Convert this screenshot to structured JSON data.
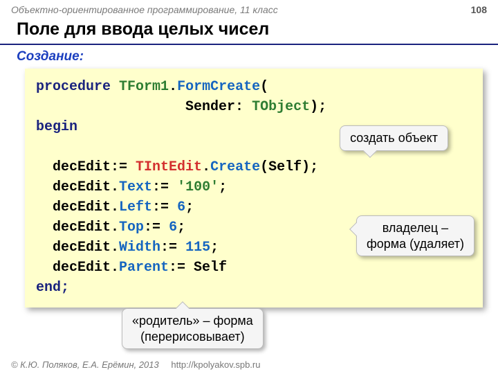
{
  "header": {
    "course": "Объектно-ориентированное программирование, 11 класс",
    "page_number": "108"
  },
  "title": "Поле для ввода целых чисел",
  "subhead": "Создание:",
  "code": {
    "kw_procedure": "procedure",
    "cls_tform1": "TForm1",
    "dot1": ".",
    "method_formcreate": "FormCreate",
    "open_paren": "(",
    "indent1": "                  ",
    "arg_sender": "Sender: ",
    "type_tobject": "TObject",
    "close_sig": ");",
    "kw_begin": "begin",
    "l1_indent": "  ",
    "l1_var": "decEdit:= ",
    "l1_cls": "TIntEdit",
    "l1_dot": ".",
    "l1_create": "Create",
    "l1_tail": "(Self);",
    "l2_indent": "  decEdit.",
    "l2_prop": "Text",
    "l2_assign": ":= ",
    "l2_val": "'100'",
    "l2_semi": ";",
    "l3_indent": "  decEdit.",
    "l3_prop": "Left",
    "l3_assign": ":= ",
    "l3_val": "6",
    "l3_semi": ";",
    "l4_indent": "  decEdit.",
    "l4_prop": "Top",
    "l4_assign": ":= ",
    "l4_val": "6",
    "l4_semi": ";",
    "l5_indent": "  decEdit.",
    "l5_prop": "Width",
    "l5_assign": ":= ",
    "l5_val": "115",
    "l5_semi": ";",
    "l6_indent": "  decEdit.",
    "l6_prop": "Parent",
    "l6_tail": ":= Self",
    "kw_end": "end;"
  },
  "callouts": {
    "c1": "создать объект",
    "c2_line1": "владелец –",
    "c2_line2": "форма (удаляет)",
    "c3_line1": "«родитель» – форма",
    "c3_line2": "(перерисовывает)"
  },
  "footer": {
    "copyright": "© К.Ю. Поляков, Е.А. Ерёмин, 2013",
    "url": "http://kpolyakov.spb.ru"
  }
}
